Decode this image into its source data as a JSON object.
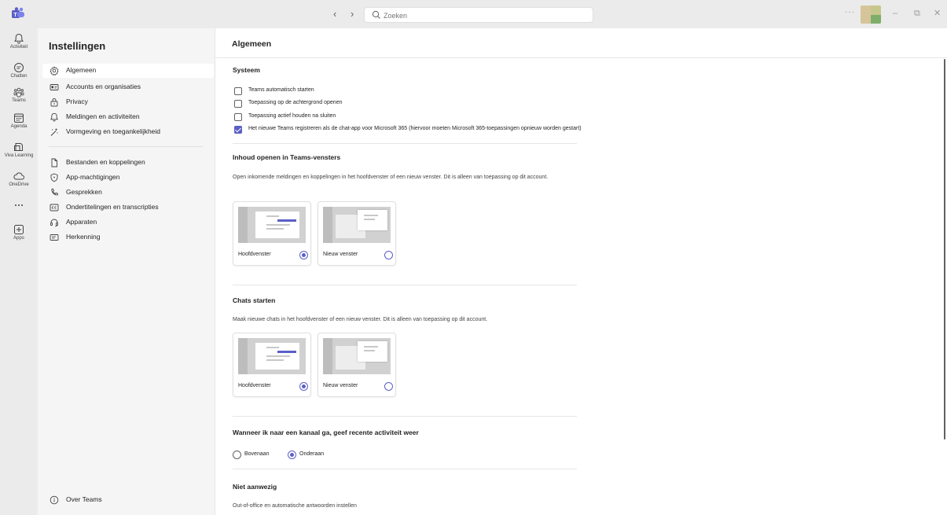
{
  "titlebar": {
    "search_placeholder": "Zoeken",
    "back": "‹",
    "forward": "›",
    "more": "···",
    "minimize": "–",
    "restore": "⧉",
    "close": "✕"
  },
  "rail": [
    {
      "label": "Activiteit",
      "icon": "bell-icon"
    },
    {
      "label": "Chatten",
      "icon": "chat-icon"
    },
    {
      "label": "Teams",
      "icon": "teams-icon"
    },
    {
      "label": "Agenda",
      "icon": "calendar-icon"
    },
    {
      "label": "Viva Learning",
      "icon": "book-icon"
    },
    {
      "label": "OneDrive",
      "icon": "cloud-icon"
    },
    {
      "label": "",
      "icon": "more-icon"
    },
    {
      "label": "Apps",
      "icon": "add-apps-icon"
    }
  ],
  "settings": {
    "title": "Instellingen",
    "items": [
      {
        "label": "Algemeen",
        "icon": "gear-icon",
        "active": true
      },
      {
        "label": "Accounts en organisaties",
        "icon": "id-card-icon"
      },
      {
        "label": "Privacy",
        "icon": "lock-icon"
      },
      {
        "label": "Meldingen en activiteiten",
        "icon": "bell-icon"
      },
      {
        "label": "Vormgeving en toegankelijkheid",
        "icon": "paint-icon"
      },
      {
        "label": "Bestanden en koppelingen",
        "icon": "file-icon"
      },
      {
        "label": "App-machtigingen",
        "icon": "shield-icon"
      },
      {
        "label": "Gesprekken",
        "icon": "phone-icon"
      },
      {
        "label": "Ondertitelingen en transcripties",
        "icon": "captions-icon"
      },
      {
        "label": "Apparaten",
        "icon": "headset-icon"
      },
      {
        "label": "Herkenning",
        "icon": "recognition-icon"
      }
    ],
    "about": "Over Teams"
  },
  "main": {
    "title": "Algemeen",
    "systeem": {
      "title": "Systeem",
      "checkboxes": [
        {
          "label": "Teams automatisch starten",
          "checked": false
        },
        {
          "label": "Toepassing op de achtergrond openen",
          "checked": false
        },
        {
          "label": "Toepassing actief houden na sluiten",
          "checked": false
        },
        {
          "label": "Het nieuwe Teams registreren als de chat-app voor Microsoft 365 (hiervoor moeten Microsoft 365-toepassingen opnieuw worden gestart)",
          "checked": true
        }
      ]
    },
    "inhoud": {
      "title": "Inhoud openen in Teams-vensters",
      "desc": "Open inkomende meldingen en koppelingen in het hoofdvenster of een nieuw venster. Dit is alleen van toepassing op dit account.",
      "options": [
        {
          "label": "Hoofdvenster",
          "selected": true
        },
        {
          "label": "Nieuw venster",
          "selected": false
        }
      ]
    },
    "chats": {
      "title": "Chats starten",
      "desc": "Maak nieuwe chats in het hoofdvenster of een nieuw venster. Dit is alleen van toepassing op dit account.",
      "options": [
        {
          "label": "Hoofdvenster",
          "selected": true
        },
        {
          "label": "Nieuw venster",
          "selected": false
        }
      ]
    },
    "kanaal": {
      "title": "Wanneer ik naar een kanaal ga, geef recente activiteit weer",
      "options": [
        {
          "label": "Bovenaan",
          "selected": false
        },
        {
          "label": "Onderaan",
          "selected": true
        }
      ]
    },
    "afwezig": {
      "title": "Niet aanwezig",
      "desc": "Out-of-office en automatische antwoorden instellen"
    }
  },
  "colors": {
    "accent": "#5b5fc7",
    "rail_bg": "#ebebeb",
    "pane_bg": "#f5f5f5"
  }
}
